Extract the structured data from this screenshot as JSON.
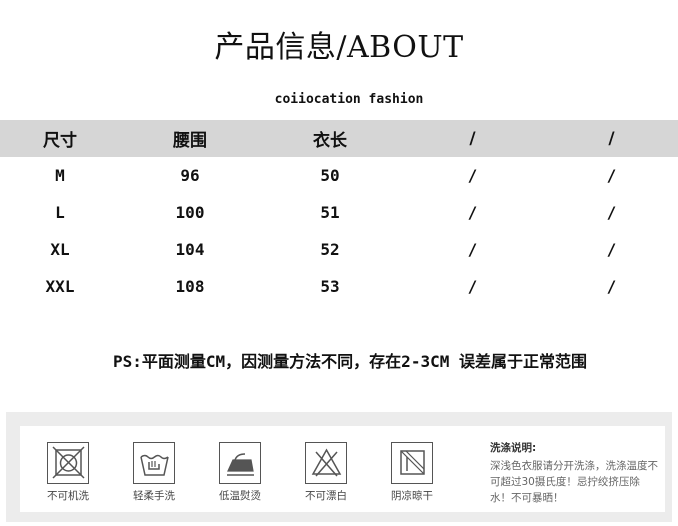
{
  "title": "产品信息/ABOUT",
  "subtitle": "coiiocation fashion",
  "table": {
    "headers": [
      "尺寸",
      "腰围",
      "衣长",
      "/",
      "/"
    ],
    "rows": [
      [
        "M",
        "96",
        "50",
        "/",
        "/"
      ],
      [
        "L",
        "100",
        "51",
        "/",
        "/"
      ],
      [
        "XL",
        "104",
        "52",
        "/",
        "/"
      ],
      [
        "XXL",
        "108",
        "53",
        "/",
        "/"
      ]
    ]
  },
  "ps_note": "PS:平面测量CM，因测量方法不同，存在2-3CM 误差属于正常范围",
  "care": {
    "items": [
      {
        "label": "不可机洗",
        "icon": "no-machine-wash-icon"
      },
      {
        "label": "轻柔手洗",
        "icon": "hand-wash-icon"
      },
      {
        "label": "低温熨烫",
        "icon": "low-iron-icon"
      },
      {
        "label": "不可漂白",
        "icon": "no-bleach-icon"
      },
      {
        "label": "阴凉晾干",
        "icon": "shade-dry-icon"
      }
    ],
    "note_title": "洗涤说明:",
    "note_text": "深浅色衣服请分开洗涤，洗涤温度不可超过30摄氏度！忌拧绞挤压除水！不可暴晒！"
  }
}
